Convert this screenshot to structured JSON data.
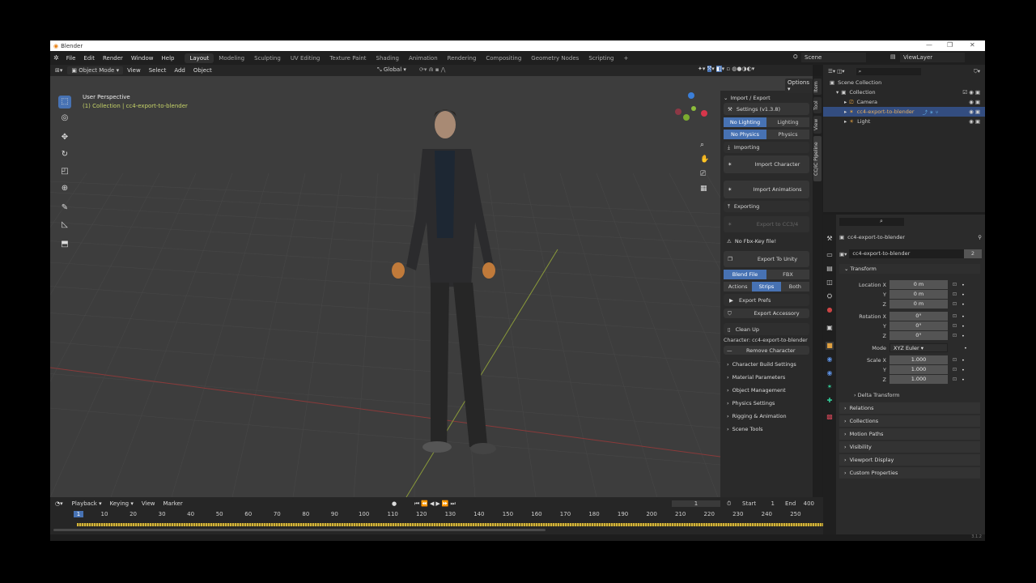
{
  "window": {
    "title": "Blender",
    "controls": [
      "—",
      "❐",
      "✕"
    ]
  },
  "menu": [
    "File",
    "Edit",
    "Render",
    "Window",
    "Help"
  ],
  "workspaces": [
    "Layout",
    "Modeling",
    "Sculpting",
    "UV Editing",
    "Texture Paint",
    "Shading",
    "Animation",
    "Rendering",
    "Compositing",
    "Geometry Nodes",
    "Scripting",
    "+"
  ],
  "top_right": {
    "scene": "Scene",
    "view_layer": "ViewLayer"
  },
  "viewport_header": {
    "mode": "Object Mode",
    "menus": [
      "View",
      "Select",
      "Add",
      "Object"
    ],
    "orientation": "Global",
    "options": "Options"
  },
  "viewport": {
    "perspective": "User Perspective",
    "collection": "(1) Collection | cc4-export-to-blender"
  },
  "npanel": {
    "header": "Import / Export",
    "settings": "Settings  (v1.3.8)",
    "lighting": [
      "No Lighting",
      "Lighting"
    ],
    "physics": [
      "No Physics",
      "Physics"
    ],
    "importing": "Importing",
    "import_character": "Import Character",
    "import_animations": "Import Animations",
    "exporting": "Exporting",
    "export_cc": "Export to CC3/4",
    "warning": "No Fbx-Key file!",
    "export_unity": "Export To Unity",
    "format": [
      "Blend File",
      "FBX"
    ],
    "anim": [
      "Actions",
      "Strips",
      "Both"
    ],
    "export_prefs": "Export Prefs",
    "export_accessory": "Export Accessory",
    "clean_up": "Clean Up",
    "character": "Character: cc4-export-to-blender",
    "remove": "Remove Character",
    "sections": [
      "Character Build Settings",
      "Material Parameters",
      "Object Management",
      "Physics Settings",
      "Rigging & Animation",
      "Scene Tools"
    ],
    "tabs": [
      "Item",
      "Tool",
      "View",
      "CC/iC Pipeline"
    ]
  },
  "outliner": {
    "root": "Scene Collection",
    "collection": "Collection",
    "items": [
      "Camera",
      "cc4-export-to-blender",
      "Light"
    ]
  },
  "properties": {
    "object_name": "cc4-export-to-blender",
    "data_name": "cc4-export-to-blender",
    "users": "2",
    "transform": "Transform",
    "location_label": "Location X",
    "rotation_label": "Rotation X",
    "scale_label": "Scale X",
    "y": "Y",
    "z": "Z",
    "location": [
      "0 m",
      "0 m",
      "0 m"
    ],
    "rotation": [
      "0°",
      "0°",
      "0°"
    ],
    "mode_label": "Mode",
    "mode": "XYZ Euler",
    "scale": [
      "1.000",
      "1.000",
      "1.000"
    ],
    "delta": "Delta Transform",
    "sections": [
      "Relations",
      "Collections",
      "Motion Paths",
      "Visibility",
      "Viewport Display",
      "Custom Properties"
    ]
  },
  "timeline": {
    "menus": [
      "Playback",
      "Keying",
      "View",
      "Marker"
    ],
    "current_frame": "1",
    "start_label": "Start",
    "start": "1",
    "end_label": "End",
    "end": "400",
    "ticks": [
      1,
      10,
      20,
      30,
      40,
      50,
      60,
      70,
      80,
      90,
      100,
      110,
      120,
      130,
      140,
      150,
      160,
      170,
      180,
      190,
      200,
      210,
      220,
      230,
      240,
      250
    ]
  },
  "status": {
    "version": "3.1.2"
  },
  "colors": {
    "accent": "#4772b3",
    "keyframe": "#d4b53a",
    "collection_text": "#c6d468"
  }
}
